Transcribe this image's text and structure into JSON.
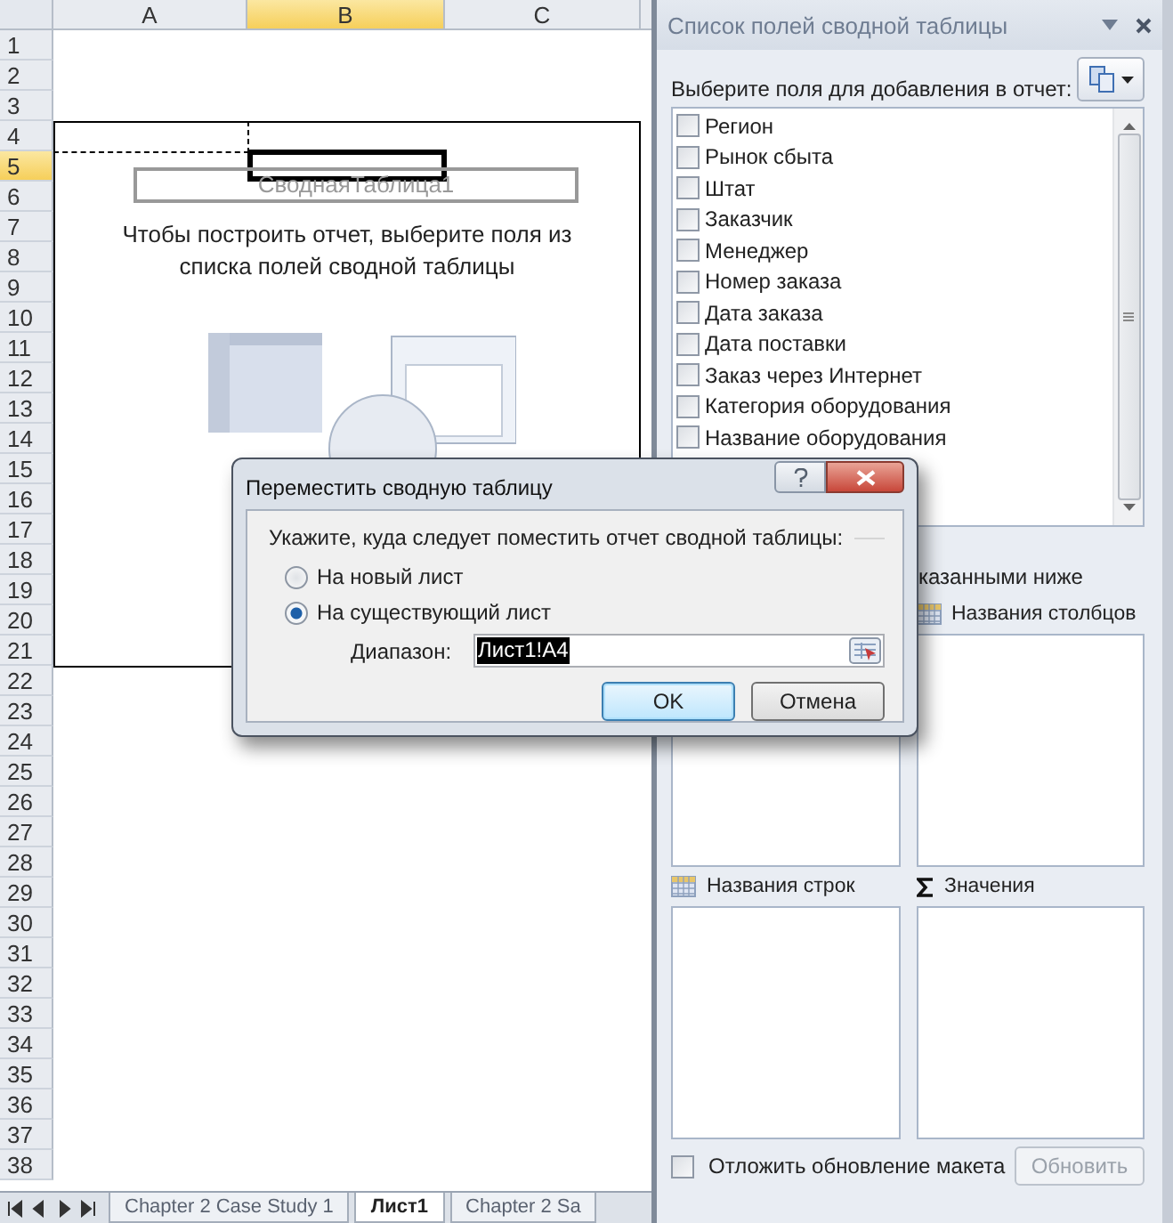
{
  "sheet": {
    "columns": [
      {
        "label": "A",
        "selected": false
      },
      {
        "label": "B",
        "selected": true
      },
      {
        "label": "C",
        "selected": false
      }
    ],
    "rows": [
      {
        "label": "1",
        "selected": false
      },
      {
        "label": "2",
        "selected": false
      },
      {
        "label": "3",
        "selected": false
      },
      {
        "label": "4",
        "selected": false
      },
      {
        "label": "5",
        "selected": true
      },
      {
        "label": "6",
        "selected": false
      },
      {
        "label": "7",
        "selected": false
      },
      {
        "label": "8",
        "selected": false
      },
      {
        "label": "9",
        "selected": false
      },
      {
        "label": "10",
        "selected": false
      },
      {
        "label": "11",
        "selected": false
      },
      {
        "label": "12",
        "selected": false
      },
      {
        "label": "13",
        "selected": false
      },
      {
        "label": "14",
        "selected": false
      },
      {
        "label": "15",
        "selected": false
      },
      {
        "label": "16",
        "selected": false
      },
      {
        "label": "17",
        "selected": false
      },
      {
        "label": "18",
        "selected": false
      },
      {
        "label": "19",
        "selected": false
      },
      {
        "label": "20",
        "selected": false
      },
      {
        "label": "21",
        "selected": false
      },
      {
        "label": "22",
        "selected": false
      },
      {
        "label": "23",
        "selected": false
      },
      {
        "label": "24",
        "selected": false
      },
      {
        "label": "25",
        "selected": false
      },
      {
        "label": "26",
        "selected": false
      },
      {
        "label": "27",
        "selected": false
      },
      {
        "label": "28",
        "selected": false
      },
      {
        "label": "29",
        "selected": false
      },
      {
        "label": "30",
        "selected": false
      },
      {
        "label": "31",
        "selected": false
      },
      {
        "label": "32",
        "selected": false
      },
      {
        "label": "33",
        "selected": false
      },
      {
        "label": "34",
        "selected": false
      },
      {
        "label": "35",
        "selected": false
      },
      {
        "label": "36",
        "selected": false
      },
      {
        "label": "37",
        "selected": false
      },
      {
        "label": "38",
        "selected": false
      }
    ],
    "pivot": {
      "name": "СводнаяТаблица1",
      "hint": "Чтобы построить отчет, выберите поля из списка полей сводной таблицы"
    }
  },
  "sheet_tabs": [
    {
      "label": "Chapter 2 Case Study 1",
      "selected": false
    },
    {
      "label": "Лист1",
      "selected": true
    },
    {
      "label": "Chapter 2 Sa",
      "selected": false
    }
  ],
  "panel": {
    "title": "Список полей сводной таблицы",
    "prompt": "Выберите поля для добавления в отчет:",
    "fields": [
      {
        "label": "Регион",
        "checked": false
      },
      {
        "label": "Рынок сбыта",
        "checked": false
      },
      {
        "label": "Штат",
        "checked": false
      },
      {
        "label": "Заказчик",
        "checked": false
      },
      {
        "label": "Менеджер",
        "checked": false
      },
      {
        "label": "Номер заказа",
        "checked": false
      },
      {
        "label": "Дата заказа",
        "checked": false
      },
      {
        "label": "Дата поставки",
        "checked": false
      },
      {
        "label": "Заказ через Интернет",
        "checked": false
      },
      {
        "label": "Категория оборудования",
        "checked": false
      },
      {
        "label": "Название оборудования",
        "checked": false
      }
    ],
    "drop_hint": "казанными ниже",
    "areas": [
      {
        "label": "Названия столбцов",
        "kind": "columns"
      },
      {
        "label": "Названия строк",
        "kind": "rows"
      },
      {
        "label": "Значения",
        "kind": "values"
      }
    ],
    "defer": {
      "label": "Отложить обновление макета",
      "checked": false
    },
    "update_button": {
      "label": "Обновить",
      "disabled": true
    }
  },
  "dialog": {
    "title": "Переместить сводную таблицу",
    "group": "Укажите, куда следует поместить отчет сводной таблицы:",
    "options": [
      {
        "label": "На новый лист",
        "selected": false
      },
      {
        "label": "На существующий лист",
        "selected": true
      }
    ],
    "range": {
      "label": "Диапазон:",
      "value": "Лист1!A4"
    },
    "buttons": [
      {
        "label": "OK",
        "default": true
      },
      {
        "label": "Отмена",
        "default": false
      }
    ]
  }
}
